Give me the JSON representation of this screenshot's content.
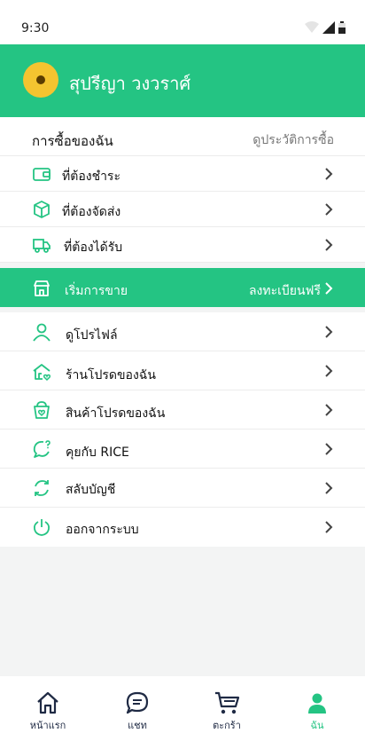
{
  "status_bar": {
    "time": "9:30"
  },
  "profile": {
    "name": "สุปรีญา วงวราศ์"
  },
  "purchases": {
    "title": "การซื้อของฉัน",
    "history_link": "ดูประวัติการซื้อ",
    "items": [
      {
        "label": "ที่ต้องชำระ",
        "icon": "wallet-icon"
      },
      {
        "label": "ที่ต้องจัดส่ง",
        "icon": "box-icon"
      },
      {
        "label": "ที่ต้องได้รับ",
        "icon": "truck-icon"
      }
    ]
  },
  "sell": {
    "label": "เริ่มการขาย",
    "action": "ลงทะเบียนฟรี",
    "icon": "store-icon"
  },
  "menu": [
    {
      "label": "ดูโปรไฟล์",
      "icon": "user-icon"
    },
    {
      "label": "ร้านโปรดของฉัน",
      "icon": "favorite-shop-icon"
    },
    {
      "label": "สินค้าโปรดของฉัน",
      "icon": "favorite-basket-icon"
    },
    {
      "label": "คุยกับ RICE",
      "icon": "chat-help-icon"
    },
    {
      "label": "สลับบัญชี",
      "icon": "switch-icon"
    },
    {
      "label": "ออกจากระบบ",
      "icon": "power-icon"
    }
  ],
  "bottom_nav": [
    {
      "label": "หน้าแรก",
      "icon": "home-icon"
    },
    {
      "label": "แชท",
      "icon": "chat-icon"
    },
    {
      "label": "ตะกร้า",
      "icon": "cart-icon"
    },
    {
      "label": "ฉัน",
      "icon": "profile-icon",
      "active": true
    }
  ],
  "colors": {
    "accent": "#24c483",
    "nav_text": "#1f2a44"
  }
}
